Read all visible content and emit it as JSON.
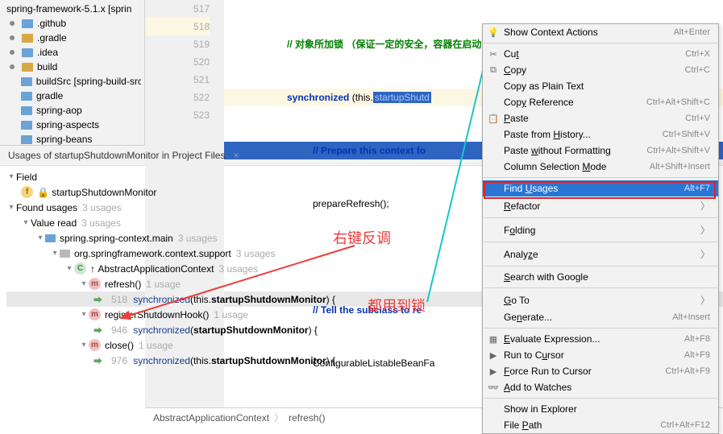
{
  "sidebar": {
    "items": [
      {
        "label": "spring-framework-5.1.x [sprin",
        "type": "title"
      },
      {
        "label": ".github",
        "type": "blue"
      },
      {
        "label": ".gradle",
        "type": "yellow"
      },
      {
        "label": ".idea",
        "type": "blue"
      },
      {
        "label": "build",
        "type": "yellow"
      },
      {
        "label": "buildSrc [spring-build-src",
        "type": "blue"
      },
      {
        "label": "gradle",
        "type": "blue"
      },
      {
        "label": "spring-aop",
        "type": "blue"
      },
      {
        "label": "spring-aspects",
        "type": "blue"
      },
      {
        "label": "spring-beans",
        "type": "blue"
      }
    ]
  },
  "editor": {
    "gutter": [
      "517",
      "518",
      "519",
      "520",
      "521",
      "522",
      "523"
    ],
    "lines": {
      "l517": "// 对象所加锁 （保证一定的安全，容器在启动或者刷新过程中不能刷新或者关闭）",
      "l518_kw": "synchronized",
      "l518_this": " (this.",
      "l518_field": "startupShutd",
      "l519": "// Prepare this context fo",
      "l520": "prepareRefresh();",
      "l522": "// Tell the subclass to re",
      "l523": "ConfigurableListableBeanFa"
    }
  },
  "breadcrumb": {
    "a": "AbstractApplicationContext",
    "b": "refresh()"
  },
  "findTab": "Usages of startupShutdownMonitor in Project Files",
  "tree": {
    "field": "Field",
    "fieldName": "startupShutdownMonitor",
    "found": "Found usages",
    "found_c": "3 usages",
    "vr": "Value read",
    "vr_c": "3 usages",
    "mod": "spring.spring-context.main",
    "mod_c": "3 usages",
    "pkg": "org.springframework.context.support",
    "pkg_c": "3 usages",
    "cls": "AbstractApplicationContext",
    "cls_c": "3 usages",
    "m1": "refresh()",
    "m1_c": "1 usage",
    "m1_line": "518",
    "m1_code1": "synchronized",
    "m1_code2": " (this.",
    "m1_code3": "startupShutdownMonitor",
    "m1_code4": ") {",
    "m2": "registerShutdownHook()",
    "m2_c": "1 usage",
    "m2_line": "946",
    "m2_code1": "synchronized",
    "m2_code2": " (",
    "m2_code3": "startupShutdownMonitor",
    "m2_code4": ") {",
    "m3": "close()",
    "m3_c": "1 usage",
    "m3_line": "976",
    "m3_code1": "synchronized",
    "m3_code2": " (this.",
    "m3_code3": "startupShutdownMonitor",
    "m3_code4": ") {"
  },
  "menu": {
    "items": [
      {
        "icon": "💡",
        "label": "Show Context Actions",
        "shortcut": "Alt+Enter"
      },
      {
        "sep": true
      },
      {
        "icon": "✂",
        "label": "Cu<u>t</u>",
        "shortcut": "Ctrl+X"
      },
      {
        "icon": "⧉",
        "label": "<u>C</u>opy",
        "shortcut": "Ctrl+C"
      },
      {
        "label": "Copy as Plain Text",
        "shortcut": ""
      },
      {
        "label": "Cop<u>y</u> Reference",
        "shortcut": "Ctrl+Alt+Shift+C"
      },
      {
        "icon": "📋",
        "label": "<u>P</u>aste",
        "shortcut": "Ctrl+V"
      },
      {
        "label": "Paste from <u>H</u>istory...",
        "shortcut": "Ctrl+Shift+V"
      },
      {
        "label": "Paste <u>w</u>ithout Formatting",
        "shortcut": "Ctrl+Alt+Shift+V"
      },
      {
        "label": "Column Selection <u>M</u>ode",
        "shortcut": "Alt+Shift+Insert"
      },
      {
        "sep": true
      },
      {
        "label": "Find <u>U</u>sages",
        "shortcut": "Alt+F7",
        "hl": true
      },
      {
        "label": "<u>R</u>efactor",
        "sub": true
      },
      {
        "sep": true
      },
      {
        "label": "F<u>o</u>lding",
        "sub": true
      },
      {
        "sep": true
      },
      {
        "label": "Analy<u>z</u>e",
        "sub": true
      },
      {
        "sep": true
      },
      {
        "label": "<u>S</u>earch with Google",
        "shortcut": ""
      },
      {
        "sep": true
      },
      {
        "label": "<u>G</u>o To",
        "sub": true
      },
      {
        "label": "Ge<u>n</u>erate...",
        "shortcut": "Alt+Insert"
      },
      {
        "sep": true
      },
      {
        "icon": "▦",
        "label": "<u>E</u>valuate Expression...",
        "shortcut": "Alt+F8"
      },
      {
        "icon": "▶",
        "label": "Run to C<u>u</u>rsor",
        "shortcut": "Alt+F9"
      },
      {
        "icon": "▶",
        "label": "<u>F</u>orce Run to Cursor",
        "shortcut": "Ctrl+Alt+F9"
      },
      {
        "icon": "👓",
        "label": "<u>A</u>dd to Watches",
        "shortcut": ""
      },
      {
        "sep": true
      },
      {
        "label": "Show in Explorer",
        "shortcut": ""
      },
      {
        "label": "File <u>P</u>ath",
        "shortcut": "Ctrl+Alt+F12"
      }
    ]
  },
  "annotations": {
    "a1": "右键反调",
    "a2": "都用到锁"
  }
}
